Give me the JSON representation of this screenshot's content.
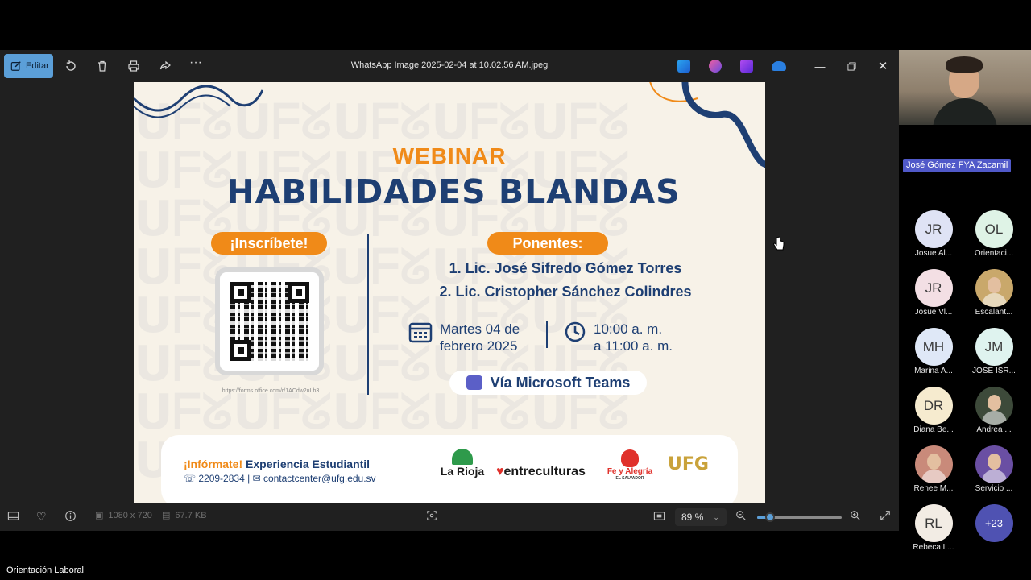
{
  "viewer": {
    "edit_label": "Editar",
    "file_title": "WhatsApp Image 2025-02-04 at 10.02.56 AM.jpeg",
    "dimensions": "1080 x 720",
    "file_size": "67.7 KB",
    "zoom": "89 %",
    "zoom_fraction": 0.15
  },
  "poster": {
    "kicker": "WEBINAR",
    "title": "HABILIDADES BLANDAS",
    "signup": "¡Inscríbete!",
    "qr_url": "https://forms.office.com/r/1ACdw2uLh3",
    "speakers_label": "Ponentes:",
    "speaker1": "1. Lic. José Sifredo Gómez Torres",
    "speaker2": "2. Lic. Cristopher Sánchez Colindres",
    "date_line1": "Martes 04 de",
    "date_line2": "febrero 2025",
    "time_line1": "10:00 a. m.",
    "time_line2": "a 11:00 a. m.",
    "platform": "Vía Microsoft Teams",
    "info_kicker": "¡Infórmate!",
    "info_title": "Experiencia Estudiantil",
    "phone": "2209-2834",
    "email": "contactcenter@ufg.edu.sv",
    "logo1": "La Rioja",
    "logo2": "entreculturas",
    "logo3": "Fe y Alegría",
    "logo3_sub": "EL SALVADOR",
    "logo4": "UFG"
  },
  "meeting": {
    "active_speaker": "José Gómez FYA Zacamil",
    "participants": [
      {
        "initials": "JR",
        "name": "Josue Al...",
        "bg": "#dfe3f5"
      },
      {
        "initials": "OL",
        "name": "Orientaci...",
        "bg": "#dff3e6"
      },
      {
        "initials": "JR",
        "name": "Josue Vl...",
        "bg": "#f3dfe4"
      },
      {
        "initials": "",
        "name": "Escalant...",
        "bg": "#c9a86b"
      },
      {
        "initials": "MH",
        "name": "Marina A...",
        "bg": "#dfe8f7"
      },
      {
        "initials": "JM",
        "name": "JOSE ISR...",
        "bg": "#dff3ef"
      },
      {
        "initials": "DR",
        "name": "Diana Be...",
        "bg": "#f6ebcf"
      },
      {
        "initials": "",
        "name": "Andrea ...",
        "bg": "#3d4a3a"
      },
      {
        "initials": "",
        "name": "Renee M...",
        "bg": "#c98a7a"
      },
      {
        "initials": "",
        "name": "Servicio ...",
        "bg": "#6a4fa3"
      },
      {
        "initials": "RL",
        "name": "Rebeca L...",
        "bg": "#f2ece4"
      }
    ],
    "overflow_count": "+23",
    "meeting_name": "Orientación Laboral"
  }
}
